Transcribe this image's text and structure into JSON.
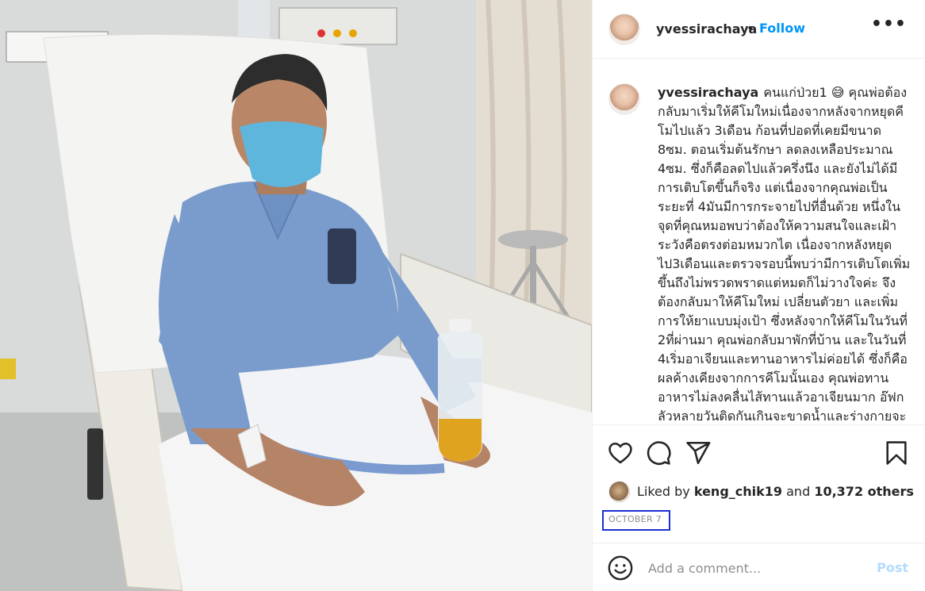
{
  "post": {
    "username": "yvessirachaya",
    "follow_label": "Follow",
    "follow_separator": "•",
    "more_label": "•••",
    "caption_text": "คนแก่ป่วย1 😅 คุณพ่อต้องกลับมาเริ่มให้คีโมใหม่เนื่องจากหลังจากหยุดคีโมไปแล้ว 3เดือน ก้อนที่ปอดที่เคยมีขนาด 8ซม. ตอนเริ่มต้นรักษา ลดลงเหลือประมาณ 4ซม. ซึ่งก็คือลดไปแล้วครึ่งนึง และยังไม่ได้มีการเติบโตขึ้นก็จริง แต่เนื่องจากคุณพ่อเป็นระยะที่ 4มันมีการกระจายไปที่อื่นด้วย หนึ่งในจุดที่คุณหมอพบว่าต้องให้ความสนใจและเฝ้าระวังคือตรงต่อมหมวกไต เนื่องจากหลังหยุดไป3เดือนและตรวจรอบนี้พบว่ามีการเติบโตเพิ่มขึ้นถึงไม่พรวดพราดแต่หมดก็ไม่วางใจค่ะ จึงต้องกลับมาให้คีโมใหม่ เปลี่ยนตัวยา และเพิ่มการให้ยาแบบมุ่งเป้า ซึ่งหลังจากให้คีโมในวันที่ 2ที่ผ่านมา คุณพ่อกลับมาพักที่บ้าน และในวันที่ 4เริ่มอาเจียนและทานอาหารไม่ค่อยได้ ซึ่งก็คือผลค้างเคียงจากการคีโมนั้นเอง คุณพ่อทานอาหารไม่ลงคลื่นไส้ทานแล้วอาเจียนมาก อ๊ฟกลัวหลายวันติดกันเกินจะขาดน้ำและร่างกายจะ",
    "likes_prefix": "Liked by",
    "liked_by_user": "keng_chik19",
    "likes_and": "and",
    "likes_others": "10,372 others",
    "date": "OCTOBER 7",
    "comment_placeholder": "Add a comment...",
    "post_label": "Post"
  },
  "icons": {
    "like": "heart-icon",
    "comment": "comment-icon",
    "share": "send-icon",
    "save": "bookmark-icon",
    "emoji": "smile-icon"
  },
  "colors": {
    "follow": "#0095f6",
    "post_disabled": "#b3dbff",
    "date_highlight": "#1a2fd6"
  }
}
